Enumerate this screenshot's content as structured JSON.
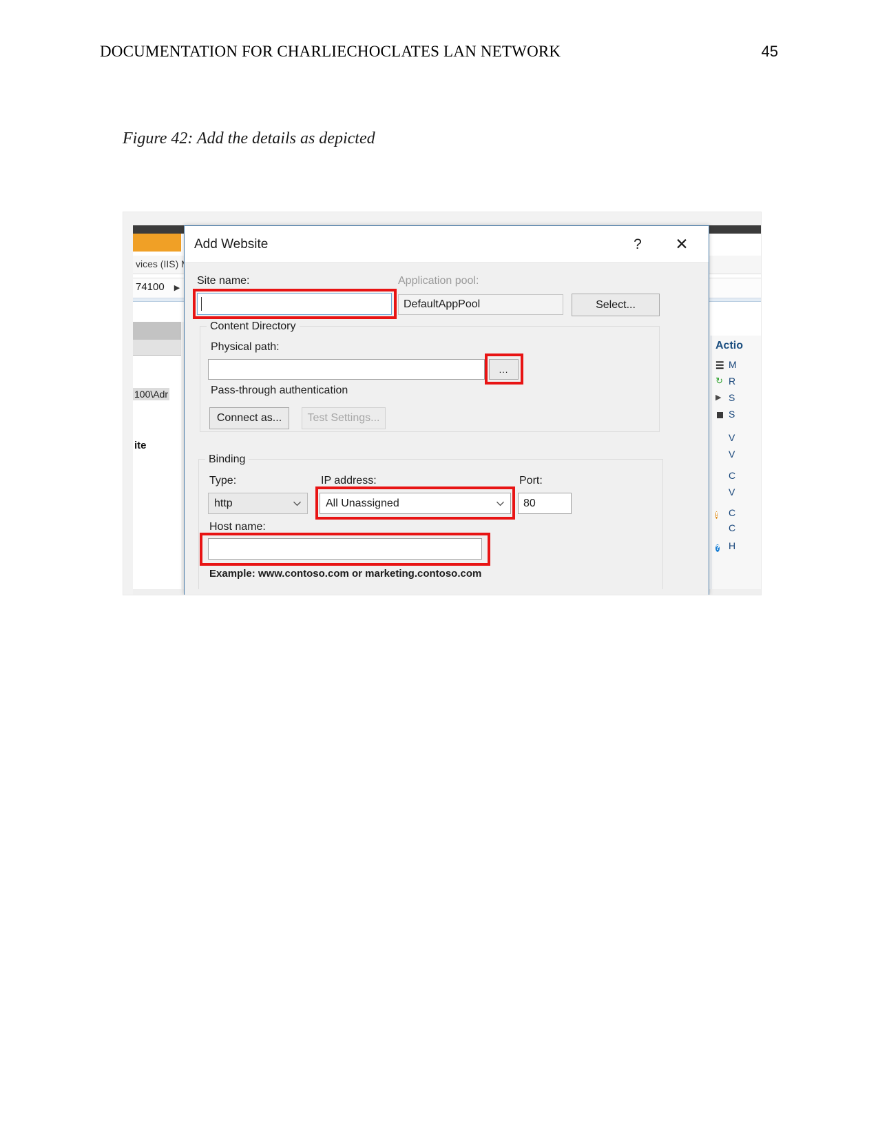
{
  "document": {
    "header_title": "DOCUMENTATION FOR CHARLIECHOCLATES LAN NETWORK",
    "page_number": "45",
    "figure_caption": "Figure 42: Add the details as depicted"
  },
  "background_window": {
    "app_label": "vices (IIS) M",
    "breadcrumb": "74100",
    "breadcrumb_arrow": "▶",
    "tree_user": "100\\Adr",
    "tree_site": "ite",
    "actions": {
      "title": "Actio",
      "items": [
        {
          "icon": "manage-icon",
          "label": "M"
        },
        {
          "icon": "restart-icon",
          "label": "R"
        },
        {
          "icon": "start-icon",
          "label": "S"
        },
        {
          "icon": "stop-icon",
          "label": "S"
        },
        {
          "icon": "browse-icon",
          "label": "V"
        },
        {
          "icon": "view-icon",
          "label": "V"
        },
        {
          "icon": "config-icon",
          "label": "C"
        },
        {
          "icon": "view-icon",
          "label": "V"
        },
        {
          "icon": "warning-icon",
          "label": "C"
        },
        {
          "icon": "config-icon",
          "label": "C"
        },
        {
          "icon": "help-icon",
          "label": "H"
        }
      ]
    }
  },
  "dialog": {
    "title": "Add Website",
    "help_glyph": "?",
    "close_glyph": "✕",
    "site_name": {
      "label": "Site name:",
      "value": "",
      "placeholder": ""
    },
    "application_pool": {
      "label": "Application pool:",
      "value": "DefaultAppPool",
      "select_button": "Select..."
    },
    "content_directory": {
      "group_label": "Content Directory",
      "physical_path_label": "Physical path:",
      "physical_path_value": "",
      "browse_button": "...",
      "pass_through_label": "Pass-through authentication",
      "connect_as_button": "Connect as...",
      "test_settings_button": "Test Settings..."
    },
    "binding": {
      "group_label": "Binding",
      "type_label": "Type:",
      "type_value": "http",
      "ip_label": "IP address:",
      "ip_value": "All Unassigned",
      "port_label": "Port:",
      "port_value": "80",
      "host_name_label": "Host name:",
      "host_name_value": "",
      "example_text": "Example: www.contoso.com or marketing.contoso.com"
    }
  },
  "annotations": {
    "highlight_color": "#e81414",
    "boxes": [
      "site-name-field",
      "physical-path-browse-button",
      "ip-address-combo",
      "host-name-field"
    ]
  }
}
